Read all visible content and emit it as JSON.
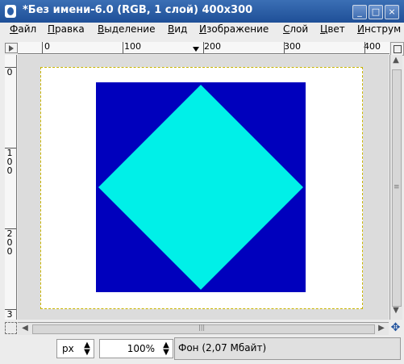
{
  "window": {
    "title": "*Без имени-6.0 (RGB, 1 слой) 400x300"
  },
  "menu": [
    "Файл",
    "Правка",
    "Выделение",
    "Вид",
    "Изображение",
    "Слой",
    "Цвет",
    "Инструм"
  ],
  "ruler": {
    "horizontal_labels": [
      "0",
      "100",
      "200",
      "300",
      "400"
    ],
    "vertical_labels": [
      "0",
      "1\n0\n0",
      "2\n0\n0",
      "3"
    ]
  },
  "image": {
    "width": 400,
    "height": 300,
    "background_color": "#ffffff",
    "square_color": "#0000bd",
    "diamond_color": "#00f0e8"
  },
  "status": {
    "unit": "px",
    "zoom": "100%",
    "message": "Фон (2,07 Мбайт)"
  },
  "icons": {
    "app": "gimp-icon",
    "minimize": "minimize-icon",
    "maximize": "maximize-icon",
    "close": "close-icon",
    "navigate": "navigate-icon"
  }
}
